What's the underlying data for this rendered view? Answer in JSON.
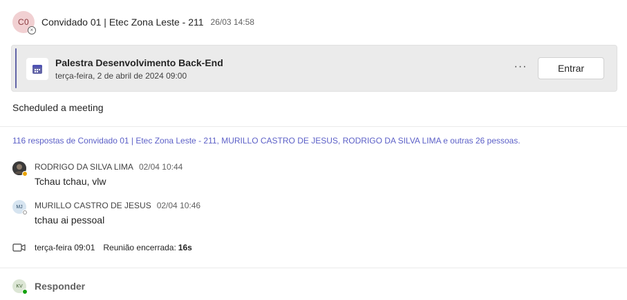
{
  "post": {
    "avatar_initials": "C0",
    "sender": "Convidado 01 | Etec Zona Leste - 211",
    "timestamp": "26/03 14:58"
  },
  "meeting_card": {
    "title": "Palestra Desenvolvimento Back-End",
    "datetime": "terça-feira, 2 de abril de 2024 09:00",
    "more_label": "···",
    "join_label": "Entrar",
    "accent_color": "#6264a7"
  },
  "message_text": "Scheduled a meeting",
  "replies_summary": "116 respostas de Convidado 01 | Etec Zona Leste - 211, MURILLO CASTRO DE JESUS, RODRIGO DA SILVA LIMA e outras 26 pessoas.",
  "replies": [
    {
      "name": "RODRIGO DA SILVA LIMA",
      "time": "02/04 10:44",
      "text": "Tchau tchau, vlw",
      "avatar": "photo",
      "presence": "away"
    },
    {
      "name": "MURILLO CASTRO DE JESUS",
      "time": "02/04 10:46",
      "text": "tchau ai pessoal",
      "avatar_initials": "MJ",
      "presence": "offline"
    }
  ],
  "meeting_ended": {
    "icon": "video-camera-icon",
    "day_time": "terça-feira 09:01",
    "status_label": "Reunião encerrada:",
    "duration": "16s"
  },
  "reply_box": {
    "avatar_initials": "KV",
    "presence": "available",
    "label": "Responder"
  }
}
